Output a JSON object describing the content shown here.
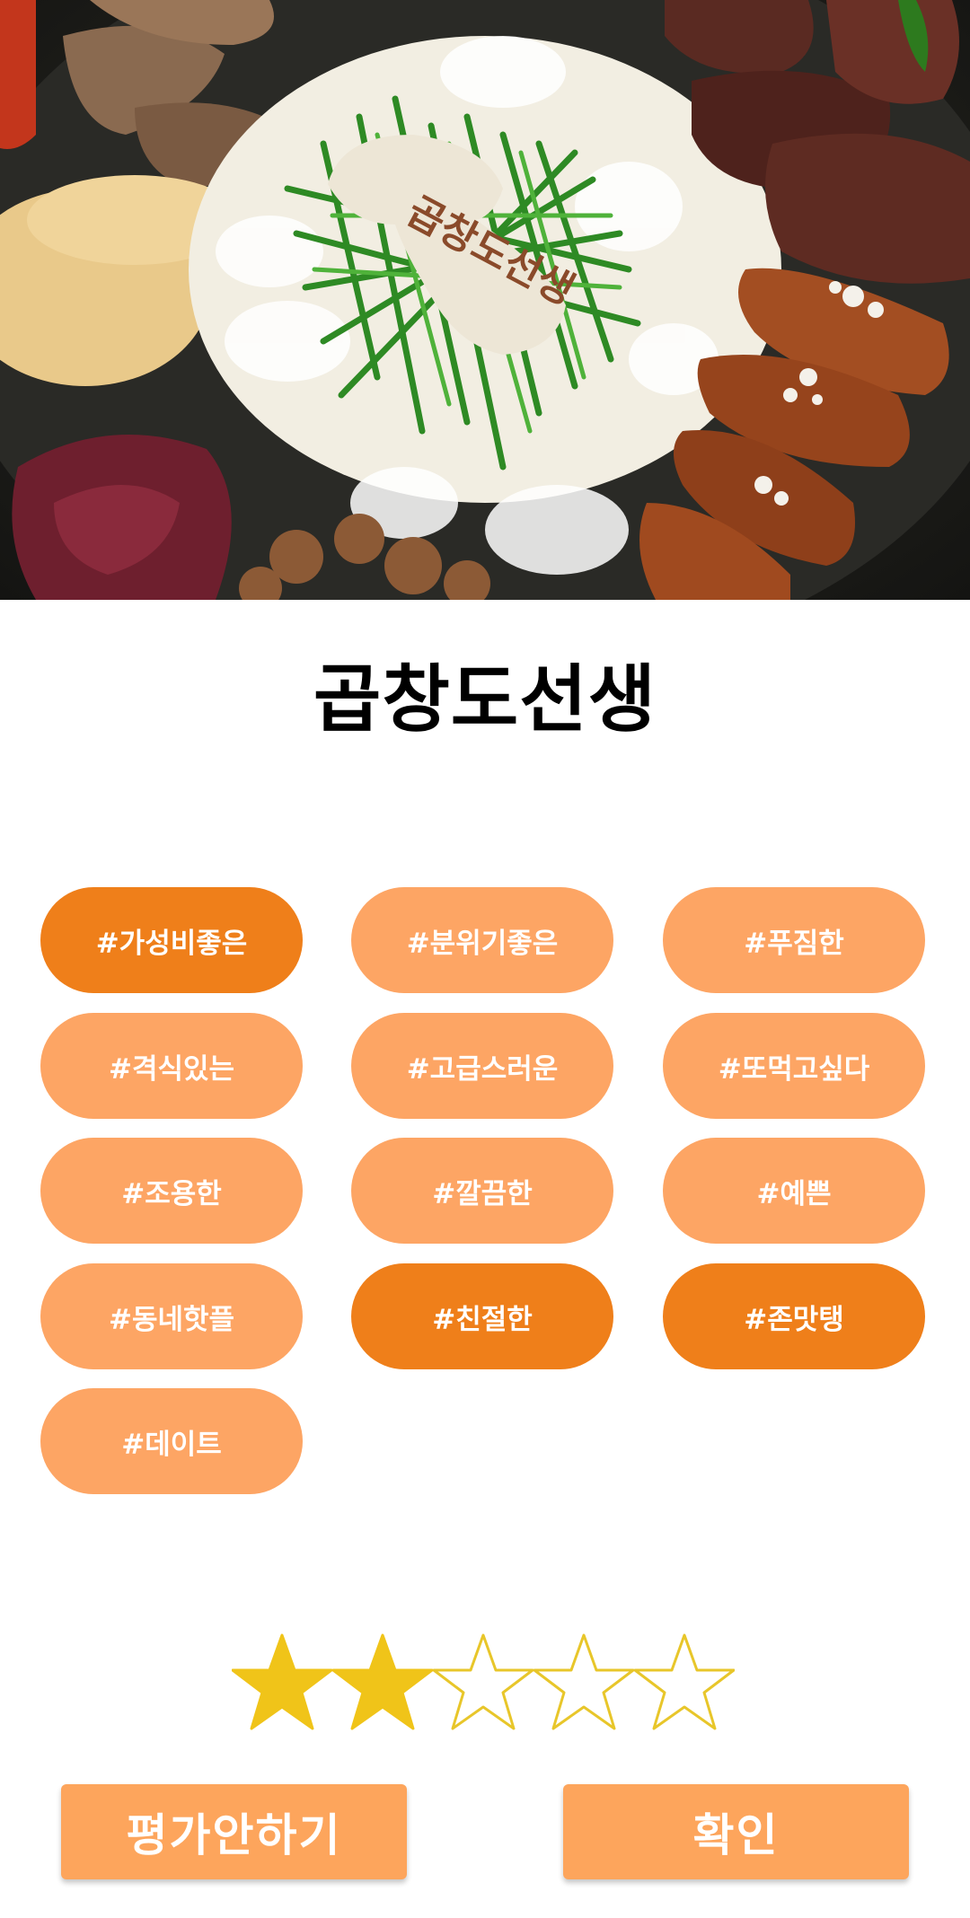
{
  "restaurant": {
    "name": "곱창도선생",
    "sign_text": "곱창도선생"
  },
  "tags": [
    {
      "label": "#가성비좋은",
      "selected": true
    },
    {
      "label": "#분위기좋은",
      "selected": false
    },
    {
      "label": "#푸짐한",
      "selected": false
    },
    {
      "label": "#격식있는",
      "selected": false
    },
    {
      "label": "#고급스러운",
      "selected": false
    },
    {
      "label": "#또먹고싶다",
      "selected": false
    },
    {
      "label": "#조용한",
      "selected": false
    },
    {
      "label": "#깔끔한",
      "selected": false
    },
    {
      "label": "#예쁜",
      "selected": false
    },
    {
      "label": "#동네핫플",
      "selected": false
    },
    {
      "label": "#친절한",
      "selected": true
    },
    {
      "label": "#존맛탱",
      "selected": true
    },
    {
      "label": "#데이트",
      "selected": false
    }
  ],
  "rating": {
    "value": 2,
    "max": 5
  },
  "buttons": {
    "skip_label": "평가안하기",
    "confirm_label": "확인"
  },
  "colors": {
    "tag_selected": "#ef7f1a",
    "tag_default": "#fda564",
    "button": "#fda55c",
    "star_filled": "#f0c419",
    "star_outline": "#e8c62a"
  }
}
